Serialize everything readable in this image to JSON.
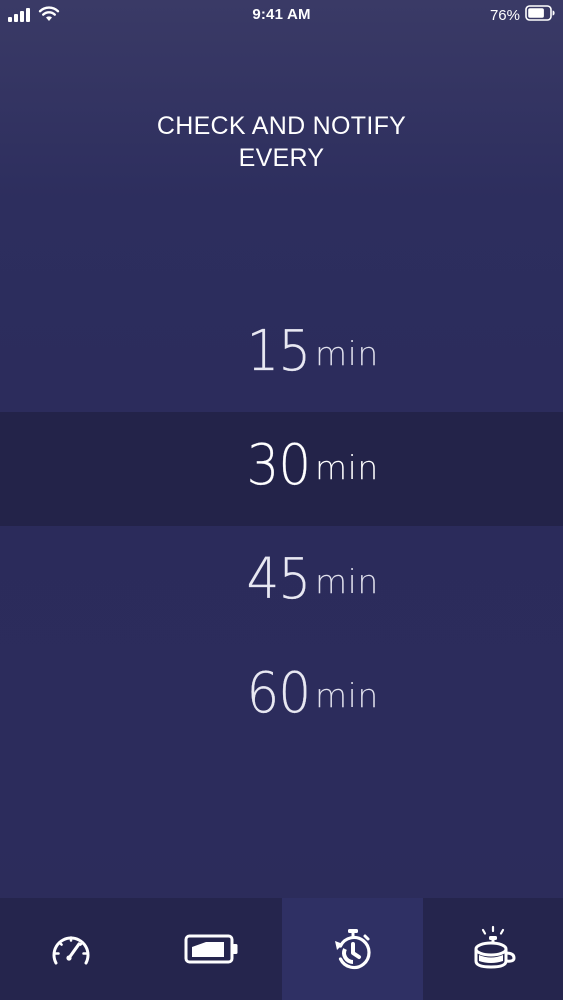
{
  "status_bar": {
    "time": "9:41 AM",
    "battery_percent": "76%",
    "battery_level": 0.76,
    "icons": [
      "cellular-signal-icon",
      "wifi-icon",
      "battery-icon"
    ]
  },
  "heading": {
    "line1": "CHECK AND NOTIFY",
    "line2": "EVERY"
  },
  "picker": {
    "selected": "30",
    "options": [
      {
        "value": "15",
        "unit": "min"
      },
      {
        "value": "30",
        "unit": "min"
      },
      {
        "value": "45",
        "unit": "min"
      },
      {
        "value": "60",
        "unit": "min"
      }
    ]
  },
  "tab_bar": {
    "active_tab": "timer",
    "tabs": [
      {
        "id": "speed",
        "icon": "speedometer-icon"
      },
      {
        "id": "battery",
        "icon": "battery-charging-icon"
      },
      {
        "id": "timer",
        "icon": "stopwatch-refresh-icon"
      },
      {
        "id": "alarm",
        "icon": "desk-bell-icon"
      }
    ]
  },
  "colors": {
    "background_top": "#3a3a66",
    "background": "#2b2b5b",
    "selected_row": "#232347",
    "tab_inactive": "#25254d",
    "tab_active": "#2f3064",
    "text": "#ffffff"
  }
}
